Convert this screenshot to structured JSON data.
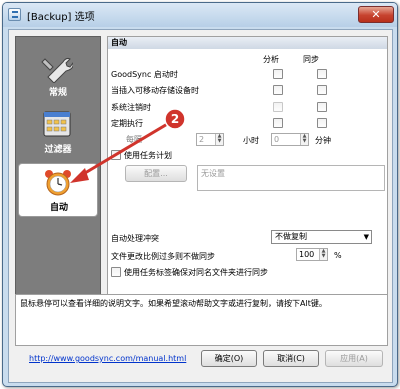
{
  "window": {
    "title": "[Backup] 选项",
    "close_glyph": "✕"
  },
  "sidebar": {
    "items": [
      {
        "label": "常规",
        "icon": "wrench-icon"
      },
      {
        "label": "过滤器",
        "icon": "filter-grid-icon"
      },
      {
        "label": "自动",
        "icon": "alarm-clock-icon",
        "selected": true
      }
    ]
  },
  "panel": {
    "title": "自动",
    "col_headers": {
      "analyze": "分析",
      "sync": "同步"
    },
    "rows": [
      {
        "label": "GoodSync 启动时"
      },
      {
        "label": "当插入可移动存储设备时"
      },
      {
        "label": "系统注销时"
      },
      {
        "label": "定期执行"
      }
    ],
    "every_prefix": "每隔",
    "hours_value": "2",
    "hours_label": "小时",
    "minutes_value": "0",
    "minutes_label": "分钟",
    "use_scheduler_label": "使用任务计划",
    "configure_button": "配置...",
    "schedule_placeholder": "无设置",
    "auto_conflict_label": "自动处理冲突",
    "auto_conflict_value": "不做复制",
    "change_ratio_label": "文件更改比例过多则不做同步",
    "change_ratio_value": "100",
    "percent": "%",
    "same_name_label": "使用任务标签确保对同名文件夹进行同步"
  },
  "description": "鼠标悬停可以查看详细的说明文字。如果希望滚动帮助文字或进行复制，请按下Alt键。",
  "help_link": "http://www.goodsync.com/manual.html",
  "buttons": {
    "ok": "确定(O)",
    "cancel": "取消(C)",
    "apply": "应用(A)"
  },
  "annotation": {
    "number": "2"
  },
  "colors": {
    "annotation_red": "#d0342c",
    "sidebar_bg": "#7d7d7d",
    "link": "#0033cc"
  }
}
